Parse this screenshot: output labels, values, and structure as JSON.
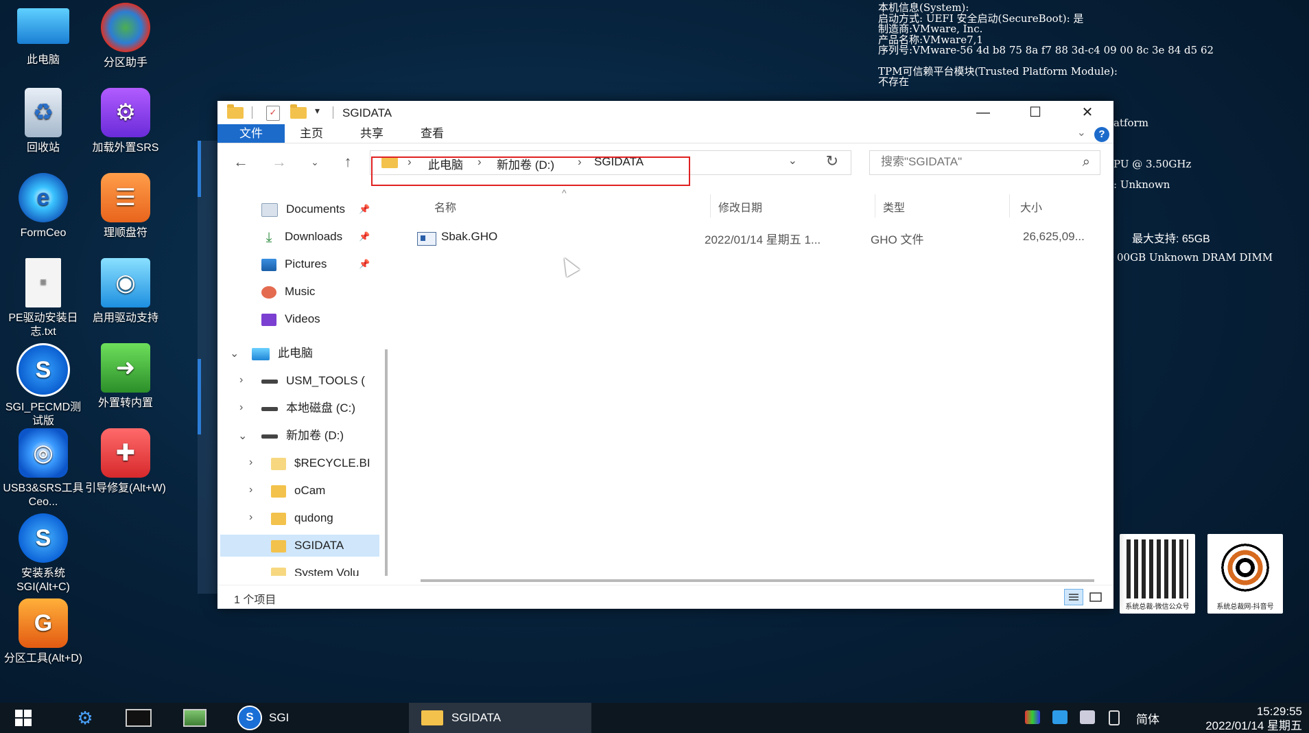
{
  "desktop": {
    "icons": [
      {
        "label": "此电脑",
        "icon": "computer-icon"
      },
      {
        "label": "分区助手",
        "icon": "partition-assistant-icon"
      },
      {
        "label": "回收站",
        "icon": "recycle-bin-icon"
      },
      {
        "label": "加载外置SRS",
        "icon": "srs-icon"
      },
      {
        "label": "FormCeo",
        "icon": "formceo-icon"
      },
      {
        "label": "理顺盘符",
        "icon": "drive-letters-icon"
      },
      {
        "label": "PE驱动安装日志.txt",
        "icon": "text-file-icon"
      },
      {
        "label": "启用驱动支持",
        "icon": "driver-support-icon"
      },
      {
        "label": "SGI_PECMD测试版",
        "icon": "sgi-icon"
      },
      {
        "label": "外置转内置",
        "icon": "external-to-internal-icon"
      },
      {
        "label": "USB3&SRS工具Ceo...",
        "icon": "usb-srs-icon"
      },
      {
        "label": "引导修复(Alt+W)",
        "icon": "boot-repair-icon"
      },
      {
        "label": "安装系统SGI(Alt+C)",
        "icon": "install-system-icon"
      },
      {
        "label": "分区工具(Alt+D)",
        "icon": "partition-tool-icon"
      }
    ]
  },
  "sysinfo": {
    "lines": [
      "本机信息(System):",
      "启动方式: UEFI    安全启动(SecureBoot): 是",
      "制造商:VMware, Inc.",
      "产品名称:VMware7,1",
      "序列号:VMware-56 4d b8 75 8a f7 88 3d-c4 09 00 8c 3e 84 d5 62",
      "",
      "TPM可信赖平台模块(Trusted Platform Module):",
      "不存在"
    ],
    "partial": {
      "platform": "atform",
      "cpu": "PU @ 3.50GHz",
      "unknown1": ": Unknown",
      "maxsupport": "最大支持: 65GB",
      "dimm": "00GB  Unknown  DRAM DIMM"
    },
    "qr_captions": [
      "系统总裁-微信公众号",
      "系统总裁网-抖音号"
    ]
  },
  "explorer": {
    "title": "SGIDATA",
    "ribbon_tabs": [
      "文件",
      "主页",
      "共享",
      "查看"
    ],
    "breadcrumbs": [
      "此电脑",
      "新加卷 (D:)",
      "SGIDATA"
    ],
    "search_placeholder": "搜索\"SGIDATA\"",
    "nav": {
      "quick": [
        {
          "label": "Documents",
          "pinned": true
        },
        {
          "label": "Downloads",
          "pinned": true
        },
        {
          "label": "Pictures",
          "pinned": true
        },
        {
          "label": "Music",
          "pinned": false
        },
        {
          "label": "Videos",
          "pinned": false
        }
      ],
      "this_pc": "此电脑",
      "drives": [
        "USM_TOOLS (",
        "本地磁盘 (C:)",
        "新加卷 (D:)"
      ],
      "folders": [
        "$RECYCLE.BI",
        "oCam",
        "qudong",
        "SGIDATA",
        "System Volu"
      ]
    },
    "columns": [
      "名称",
      "修改日期",
      "类型",
      "大小"
    ],
    "files": [
      {
        "name": "Sbak.GHO",
        "modified": "2022/01/14 星期五 1...",
        "type": "GHO 文件",
        "size": "26,625,09..."
      }
    ],
    "status": "1 个项目"
  },
  "taskbar": {
    "sgi_label": "SGI",
    "active_window": "SGIDATA",
    "ime": "简体",
    "time": "15:29:55",
    "date": "2022/01/14 星期五"
  }
}
